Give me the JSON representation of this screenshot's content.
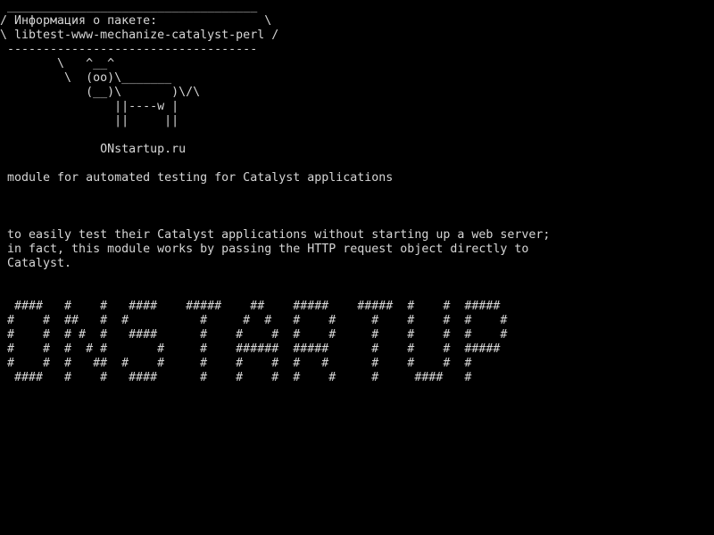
{
  "terminal": {
    "background": "#000000",
    "foreground": "#d6d6d6",
    "balloon": {
      "top_border": " ___________________________________ ",
      "line1": "/ Информация о пакете:               \\",
      "line2": "\\ libtest-www-mechanize-catalyst-perl /",
      "bottom_border": " ----------------------------------- "
    },
    "cow": [
      "        \\   ^__^",
      "         \\  (oo)\\_______",
      "            (__)\\       )\\/\\",
      "                ||----w |",
      "                ||     ||"
    ],
    "site": "              ONstartup.ru",
    "summary": " module for automated testing for Catalyst applications",
    "description": [
      " to easily test their Catalyst applications without starting up a web server;",
      " in fact, this module works by passing the HTTP request object directly to",
      " Catalyst."
    ],
    "banner": [
      "  ####   #    #   ####    #####    ##    #####    #####  #    #  #####",
      " #    #  ##   #  #          #     #  #   #    #     #    #    #  #    #",
      " #    #  # #  #   ####      #    #    #  #    #     #    #    #  #    #",
      " #    #  #  # #       #     #    ######  #####      #    #    #  #####",
      " #    #  #   ##  #    #     #    #    #  #   #      #    #    #  #",
      "  ####   #    #   ####      #    #    #  #    #     #     ####   #"
    ]
  }
}
